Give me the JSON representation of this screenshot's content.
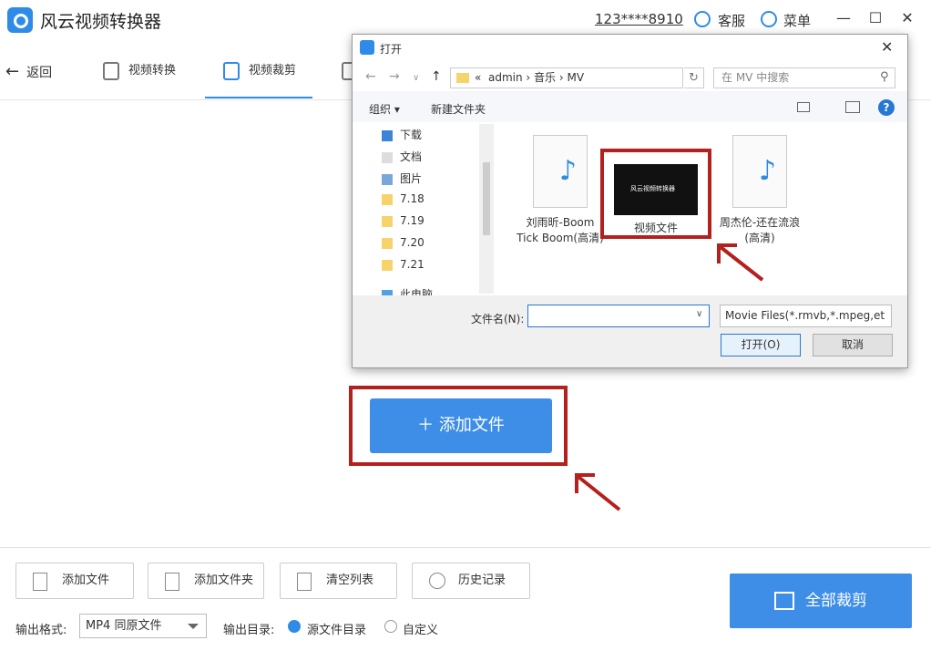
{
  "app": {
    "title": "风云视频转换器",
    "phone": "123****8910",
    "service": "客服",
    "menu": "菜单"
  },
  "nav": {
    "back": "返回",
    "tabs": [
      {
        "label": "视频转换"
      },
      {
        "label": "视频裁剪"
      }
    ]
  },
  "main": {
    "add_file_button": "＋ 添加文件"
  },
  "bottom": {
    "tools": [
      "添加文件",
      "添加文件夹",
      "清空列表",
      "历史记录"
    ],
    "format_label": "输出格式:",
    "format_value": "MP4 同原文件",
    "outdir_label": "输出目录:",
    "outdir_options": [
      "源文件目录",
      "自定义"
    ],
    "crop_all": "全部裁剪"
  },
  "dialog": {
    "title": "打开",
    "path": [
      "«",
      "admin",
      "音乐",
      "MV"
    ],
    "search_placeholder": "在 MV 中搜索",
    "organize": "组织 ▾",
    "new_folder": "新建文件夹",
    "tree": [
      "下载",
      "文档",
      "图片",
      "7.18",
      "7.19",
      "7.20",
      "7.21",
      "此电脑"
    ],
    "files": [
      {
        "name": "刘雨昕-Boom Tick Boom(高清)"
      },
      {
        "name": "视频文件",
        "thumb_text": "风云视频转换器"
      },
      {
        "name": "周杰伦-还在流浪(高清)"
      }
    ],
    "filename_label": "文件名(N):",
    "filter": "Movie Files(*.rmvb,*.mpeg,et",
    "open": "打开(O)",
    "cancel": "取消"
  },
  "colors": {
    "accent": "#3e8ee8",
    "highlight": "#b3201e"
  }
}
